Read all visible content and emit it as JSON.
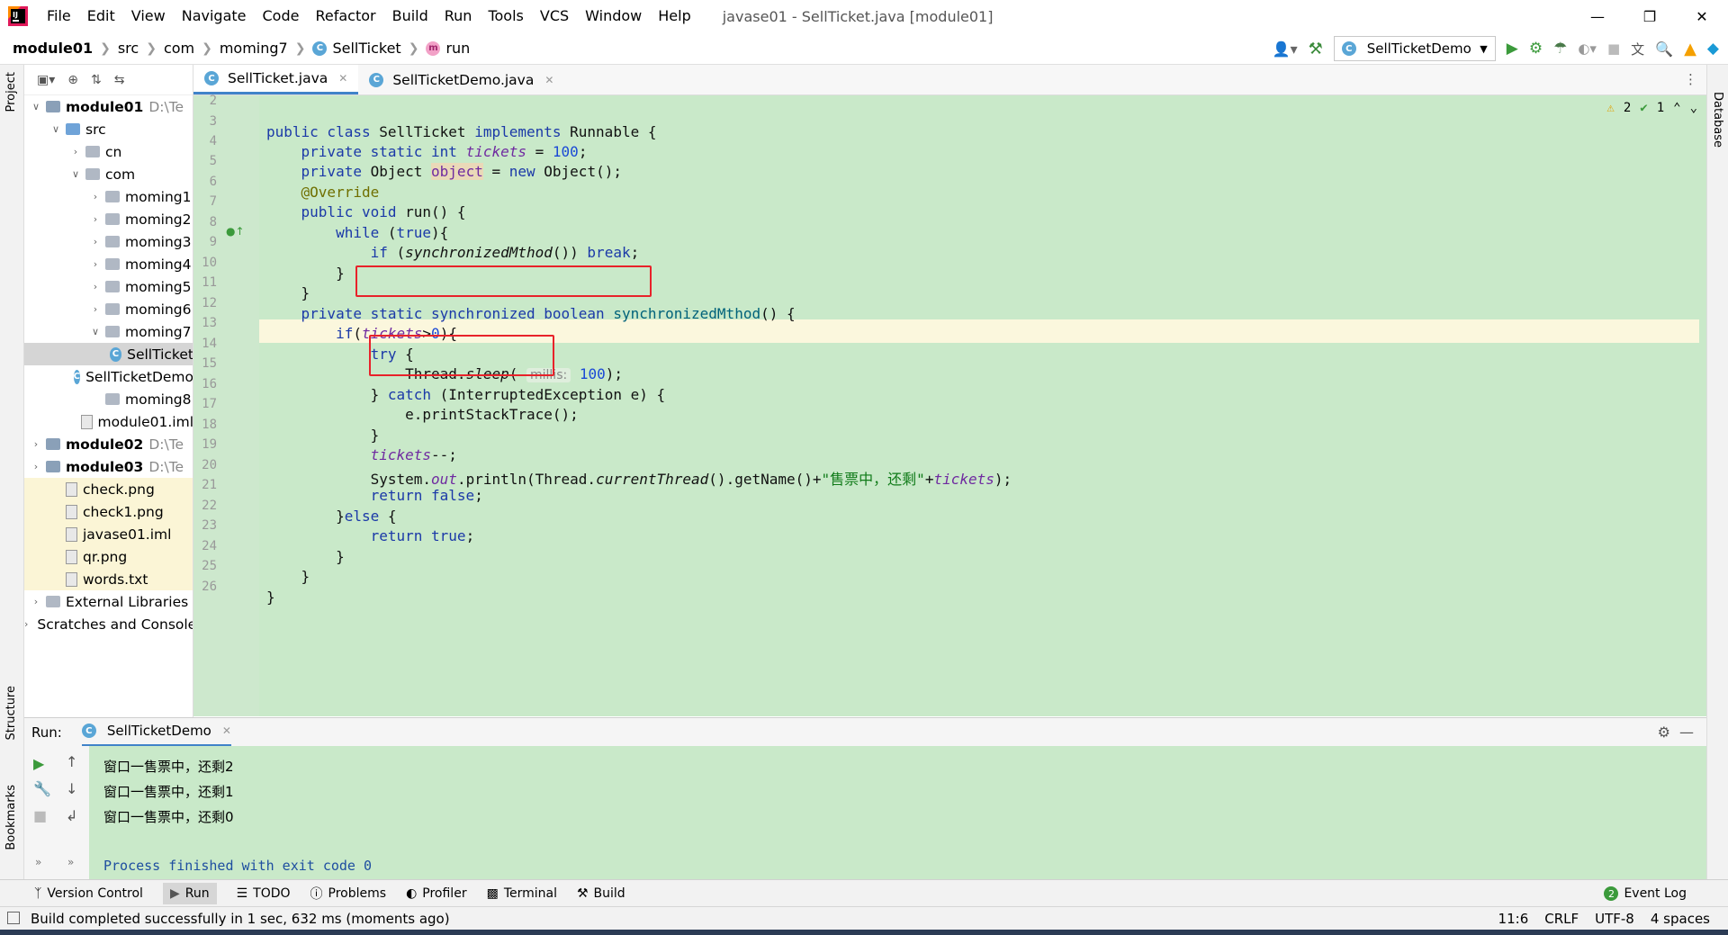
{
  "menu": {
    "items": [
      "File",
      "Edit",
      "View",
      "Navigate",
      "Code",
      "Refactor",
      "Build",
      "Run",
      "Tools",
      "VCS",
      "Window",
      "Help"
    ],
    "window_title": "javase01 - SellTicket.java [module01]"
  },
  "breadcrumb": {
    "items": [
      "module01",
      "src",
      "com",
      "moming7",
      "SellTicket",
      "run"
    ]
  },
  "toolbar": {
    "run_config": "SellTicketDemo"
  },
  "side_labels": {
    "project": "Project",
    "structure": "Structure",
    "bookmarks": "Bookmarks",
    "database": "Database"
  },
  "project_tree": [
    {
      "label": "module01",
      "path": "D:\\Te",
      "bold": true,
      "depth": 0,
      "arrow": "v",
      "icon": "module"
    },
    {
      "label": "src",
      "depth": 1,
      "arrow": "v",
      "icon": "folder-blue"
    },
    {
      "label": "cn",
      "depth": 2,
      "arrow": ">",
      "icon": "folder"
    },
    {
      "label": "com",
      "depth": 2,
      "arrow": "v",
      "icon": "folder"
    },
    {
      "label": "moming1",
      "depth": 3,
      "arrow": ">",
      "icon": "folder"
    },
    {
      "label": "moming2",
      "depth": 3,
      "arrow": ">",
      "icon": "folder"
    },
    {
      "label": "moming3",
      "depth": 3,
      "arrow": ">",
      "icon": "folder"
    },
    {
      "label": "moming4",
      "depth": 3,
      "arrow": ">",
      "icon": "folder"
    },
    {
      "label": "moming5",
      "depth": 3,
      "arrow": ">",
      "icon": "folder"
    },
    {
      "label": "moming6",
      "depth": 3,
      "arrow": ">",
      "icon": "folder"
    },
    {
      "label": "moming7",
      "depth": 3,
      "arrow": "v",
      "icon": "folder"
    },
    {
      "label": "SellTicket",
      "depth": 4,
      "arrow": "",
      "icon": "class",
      "selected": true
    },
    {
      "label": "SellTicketDemo",
      "depth": 4,
      "arrow": "",
      "icon": "class-run"
    },
    {
      "label": "moming8",
      "depth": 3,
      "arrow": "",
      "icon": "folder"
    },
    {
      "label": "module01.iml",
      "depth": 2,
      "arrow": "",
      "icon": "file"
    },
    {
      "label": "module02",
      "path": "D:\\Te",
      "bold": true,
      "depth": 0,
      "arrow": ">",
      "icon": "module"
    },
    {
      "label": "module03",
      "path": "D:\\Te",
      "bold": true,
      "depth": 0,
      "arrow": ">",
      "icon": "module"
    },
    {
      "label": "check.png",
      "depth": 1,
      "arrow": "",
      "icon": "image",
      "yellow": true
    },
    {
      "label": "check1.png",
      "depth": 1,
      "arrow": "",
      "icon": "image",
      "yellow": true
    },
    {
      "label": "javase01.iml",
      "depth": 1,
      "arrow": "",
      "icon": "file",
      "yellow": true
    },
    {
      "label": "qr.png",
      "depth": 1,
      "arrow": "",
      "icon": "image",
      "yellow": true
    },
    {
      "label": "words.txt",
      "depth": 1,
      "arrow": "",
      "icon": "text",
      "yellow": true
    },
    {
      "label": "External Libraries",
      "depth": 0,
      "arrow": ">",
      "icon": "libs"
    },
    {
      "label": "Scratches and Consoles",
      "depth": 0,
      "arrow": ">",
      "icon": "scratch"
    }
  ],
  "tabs": [
    {
      "label": "SellTicket.java",
      "active": true
    },
    {
      "label": "SellTicketDemo.java",
      "active": false
    }
  ],
  "editor": {
    "warnings": "2",
    "checks": "1",
    "line_numbers": [
      "2",
      "3",
      "4",
      "5",
      "6",
      "7",
      "8",
      "9",
      "10",
      "11",
      "12",
      "13",
      "14",
      "15",
      "16",
      "17",
      "18",
      "19",
      "20",
      "21",
      "22",
      "23",
      "24",
      "25",
      "26"
    ],
    "hint_millis": "millis:",
    "string_literal": "\"售票中，还剩\""
  },
  "run_panel": {
    "label": "Run:",
    "tab": "SellTicketDemo",
    "output": [
      "窗口一售票中，还剩2",
      "窗口一售票中，还剩1",
      "窗口一售票中，还剩0"
    ],
    "process": "Process finished with exit code 0"
  },
  "bottom_tabs": [
    "Version Control",
    "Run",
    "TODO",
    "Problems",
    "Profiler",
    "Terminal",
    "Build"
  ],
  "event_log": "Event Log",
  "status": {
    "message": "Build completed successfully in 1 sec, 632 ms (moments ago)",
    "position": "11:6",
    "line_sep": "CRLF",
    "encoding": "UTF-8",
    "indent": "4 spaces"
  },
  "colors": {
    "editor_bg": "#c9e9c9",
    "current_line": "#fbf7dd",
    "highlight_box": "#e8222a",
    "accent": "#4083c9"
  }
}
